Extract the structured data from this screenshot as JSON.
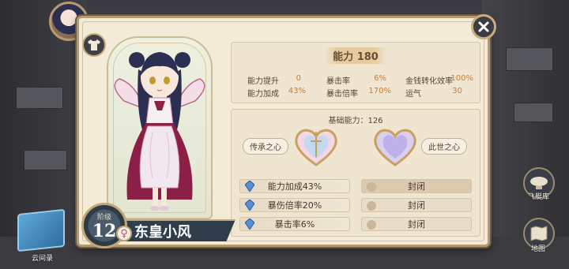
{
  "panel": {
    "stats": {
      "title_label": "能力",
      "title_value": "180",
      "rows": [
        {
          "label": "能力提升",
          "value": "0"
        },
        {
          "label": "暴击率",
          "value": "6%"
        },
        {
          "label": "金钱转化效率",
          "value": "100%"
        },
        {
          "label": "能力加成",
          "value": "43%"
        },
        {
          "label": "暴击倍率",
          "value": "170%"
        },
        {
          "label": "运气",
          "value": "30"
        }
      ]
    },
    "hearts": {
      "base_power": "基础能力：126",
      "left_label": "传承之心",
      "right_label": "此世之心"
    },
    "skills_left": [
      "能力加成43%",
      "暴伤倍率20%",
      "暴击率6%"
    ],
    "skills_right": [
      "封闭",
      "封闭",
      "封闭"
    ]
  },
  "character": {
    "level_label": "阶级",
    "level": "12",
    "name": "东皇小风",
    "gender_symbol": "♀"
  },
  "side": {
    "airship_label": "飞艇库",
    "map_label": "地图",
    "cloud_record_label": "云间录"
  },
  "colors": {
    "accent_value": "#d27a2a",
    "frame_gold": "#b49a70",
    "panel_bg": "#f3ead8"
  },
  "icons": {
    "close": "close-icon",
    "wardrobe": "shirt-icon",
    "gem": "blue-crystal-icon",
    "female": "female-icon"
  }
}
